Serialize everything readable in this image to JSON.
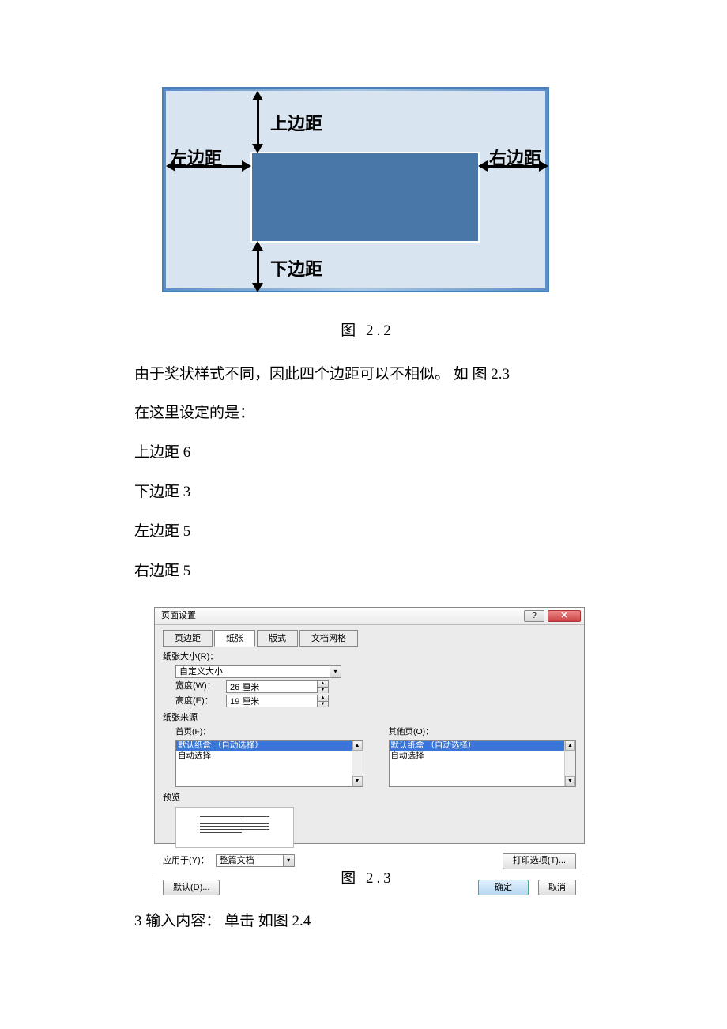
{
  "fig22": {
    "top": "上边距",
    "bottom": "下边距",
    "left": "左边距",
    "right": "右边距",
    "caption": "图 2.2"
  },
  "text": {
    "p1": "由于奖状样式不同，因此四个边距可以不相似。 如 图   2.3",
    "p2": "在这里设定的是：",
    "p3": "上边距 6",
    "p4": "下边距 3",
    "p5": "左边距 5",
    "p6": "右边距 5"
  },
  "fig23": {
    "title": "页面设置",
    "help": "?",
    "close": "✕",
    "tabs": {
      "margins": "页边距",
      "paper": "纸张",
      "layout": "版式",
      "grid": "文档网格"
    },
    "paper_size": {
      "label": "纸张大小(R)：",
      "value": "自定义大小",
      "width_label": "宽度(W)：",
      "width_value": "26 厘米",
      "height_label": "高度(E)：",
      "height_value": "19 厘米"
    },
    "paper_source": {
      "label": "纸张来源",
      "first_label": "首页(F)：",
      "other_label": "其他页(O)：",
      "opt_default": "默认纸盒 （自动选择）",
      "opt_auto": "自动选择"
    },
    "preview_label": "预览",
    "apply": {
      "label": "应用于(Y)：",
      "value": "整篇文档"
    },
    "print_options": "打印选项(T)...",
    "default_btn": "默认(D)...",
    "ok": "确定",
    "cancel": "取消",
    "caption": "图 2.3"
  },
  "step3": "3 输入内容：   单击   如图 2.4"
}
